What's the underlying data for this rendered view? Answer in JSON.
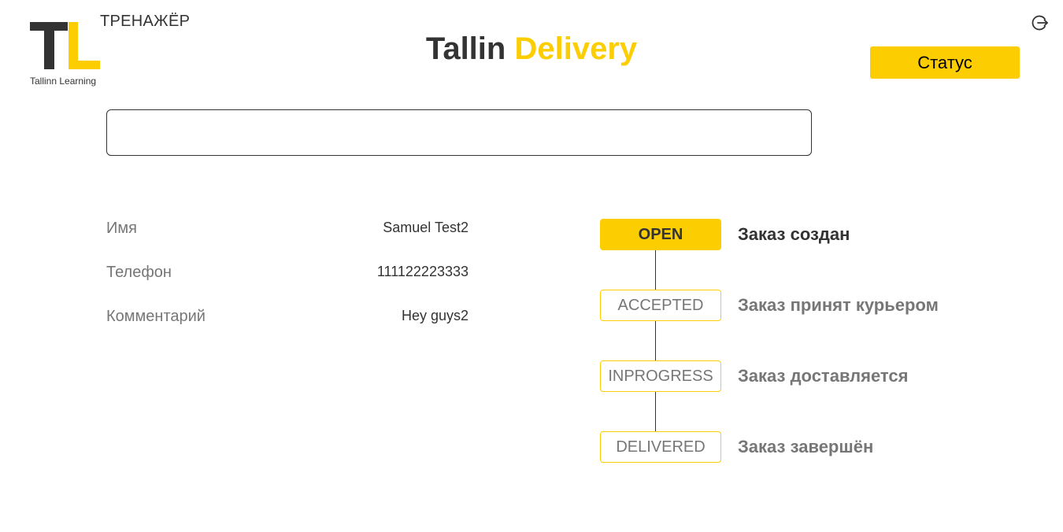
{
  "logo": {
    "letters": "TL",
    "subtitle": "Tallinn Learning",
    "trainer_label": "ТРЕНАЖЁР"
  },
  "header": {
    "title_part1": "Tallin",
    "title_part2": "Delivery",
    "status_button_label": "Статус",
    "logout_icon": "logout-icon"
  },
  "search": {
    "value": "",
    "placeholder": ""
  },
  "order_info": {
    "name_label": "Имя",
    "name_value": "Samuel Test2",
    "phone_label": "Телефон",
    "phone_value": "111122223333",
    "comment_label": "Комментарий",
    "comment_value": "Hey guys2"
  },
  "timeline": {
    "steps": [
      {
        "badge": "OPEN",
        "text": "Заказ создан",
        "active": true
      },
      {
        "badge": "ACCEPTED",
        "text": "Заказ принят курьером",
        "active": false
      },
      {
        "badge": "INPROGRESS",
        "text": "Заказ доставляется",
        "active": false
      },
      {
        "badge": "DELIVERED",
        "text": "Заказ завершён",
        "active": false
      }
    ]
  },
  "colors": {
    "accent": "#fccd00",
    "dark": "#333333",
    "muted": "#767676"
  }
}
